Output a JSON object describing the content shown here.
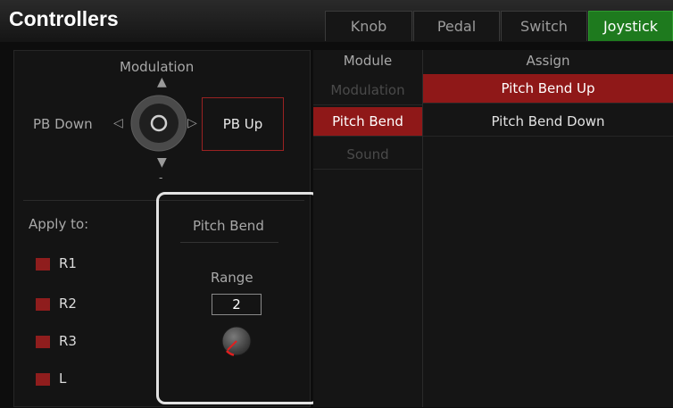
{
  "header": {
    "title": "Controllers"
  },
  "tabs": [
    {
      "label": "Knob"
    },
    {
      "label": "Pedal"
    },
    {
      "label": "Switch"
    },
    {
      "label": "Joystick"
    }
  ],
  "joystick": {
    "up_label": "Modulation",
    "left_label": "PB Down",
    "right_label": "PB Up",
    "down_label": "-"
  },
  "apply": {
    "title": "Apply to:",
    "parts": [
      {
        "label": "R1",
        "checked": true
      },
      {
        "label": "R2",
        "checked": true
      },
      {
        "label": "R3",
        "checked": true
      },
      {
        "label": "L",
        "checked": true
      }
    ]
  },
  "pitch_bend": {
    "title": "Pitch Bend",
    "range_label": "Range",
    "range_value": "2",
    "knob_level": 0.1
  },
  "module": {
    "header": "Module",
    "items": [
      {
        "label": "Modulation"
      },
      {
        "label": "Pitch Bend"
      },
      {
        "label": "Sound"
      }
    ]
  },
  "assign": {
    "header": "Assign",
    "items": [
      {
        "label": "Pitch Bend Up"
      },
      {
        "label": "Pitch Bend Down"
      }
    ]
  },
  "colors": {
    "accent_red": "#8f1818",
    "active_tab": "#1e7a1e"
  }
}
